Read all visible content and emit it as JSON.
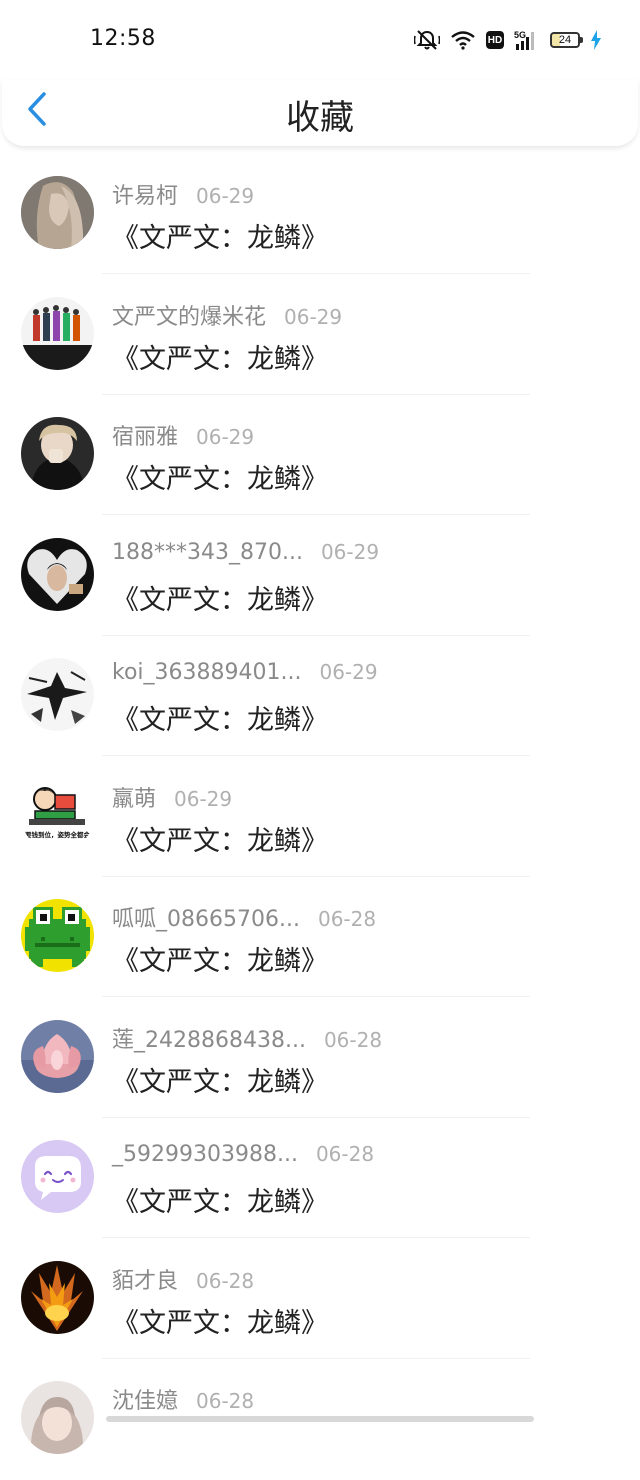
{
  "status_bar": {
    "time": "12:58",
    "icons": [
      "mute-bell-icon",
      "wifi-icon",
      "hd-icon",
      "5g-signal-icon",
      "battery-icon",
      "charging-bolt-icon"
    ],
    "hd_label": "HD",
    "network_label": "5G",
    "battery_level": "24"
  },
  "header": {
    "back_icon": "chevron-left-icon",
    "title": "收藏",
    "accent_color": "#2a8fe0"
  },
  "list": {
    "items": [
      {
        "name": "许易柯",
        "date": "06-29",
        "title": "《文严文：龙鳞》",
        "avatar": "photo-girl-long-hair"
      },
      {
        "name": "文严文的爆米花",
        "date": "06-29",
        "title": "《文严文：龙鳞》",
        "avatar": "photo-group-dancers"
      },
      {
        "name": "宿丽雅",
        "date": "06-29",
        "title": "《文严文：龙鳞》",
        "avatar": "photo-person-hoodie"
      },
      {
        "name": "188***343_870...",
        "date": "06-29",
        "title": "《文严文：龙鳞》",
        "avatar": "photo-heart-hands"
      },
      {
        "name": "koi_363889401...",
        "date": "06-29",
        "title": "《文严文：龙鳞》",
        "avatar": "photo-ink-sketch"
      },
      {
        "name": "羸萌",
        "date": "06-29",
        "title": "《文严文：龙鳞》",
        "avatar": "cartoon-boy-desk"
      },
      {
        "name": "呱呱_08665706...",
        "date": "06-28",
        "title": "《文严文：龙鳞》",
        "avatar": "pixel-frog"
      },
      {
        "name": "莲_2428868438...",
        "date": "06-28",
        "title": "《文严文：龙鳞》",
        "avatar": "photo-lotus-flower"
      },
      {
        "name": "_59299303988...",
        "date": "06-28",
        "title": "《文严文：龙鳞》",
        "avatar": "chat-bubble-face"
      },
      {
        "name": "貊才良",
        "date": "06-28",
        "title": "《文严文：龙鳞》",
        "avatar": "photo-fire-burst"
      },
      {
        "name": "沈佳嬑",
        "date": "06-28",
        "title": "",
        "avatar": "photo-girl-portrait"
      }
    ],
    "avatar_text_5": "要钱到位，姿势全都会"
  }
}
